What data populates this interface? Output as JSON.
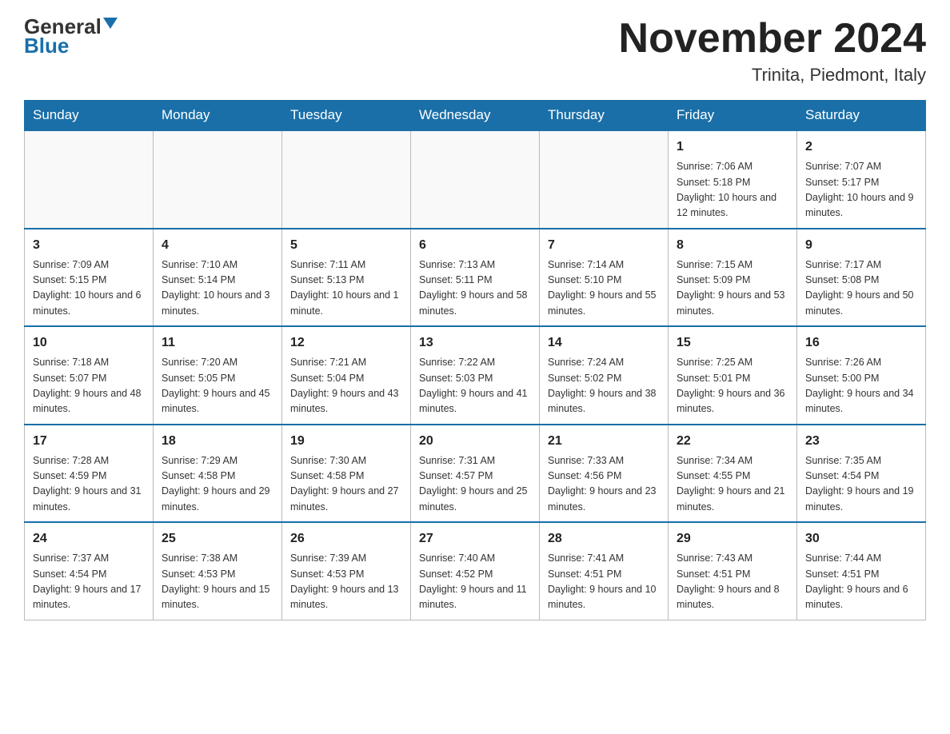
{
  "logo": {
    "general": "General",
    "blue": "Blue",
    "tagline": "GeneralBlue"
  },
  "title": "November 2024",
  "subtitle": "Trinita, Piedmont, Italy",
  "days_of_week": [
    "Sunday",
    "Monday",
    "Tuesday",
    "Wednesday",
    "Thursday",
    "Friday",
    "Saturday"
  ],
  "weeks": [
    [
      {
        "day": "",
        "info": ""
      },
      {
        "day": "",
        "info": ""
      },
      {
        "day": "",
        "info": ""
      },
      {
        "day": "",
        "info": ""
      },
      {
        "day": "",
        "info": ""
      },
      {
        "day": "1",
        "info": "Sunrise: 7:06 AM\nSunset: 5:18 PM\nDaylight: 10 hours\nand 12 minutes."
      },
      {
        "day": "2",
        "info": "Sunrise: 7:07 AM\nSunset: 5:17 PM\nDaylight: 10 hours\nand 9 minutes."
      }
    ],
    [
      {
        "day": "3",
        "info": "Sunrise: 7:09 AM\nSunset: 5:15 PM\nDaylight: 10 hours\nand 6 minutes."
      },
      {
        "day": "4",
        "info": "Sunrise: 7:10 AM\nSunset: 5:14 PM\nDaylight: 10 hours\nand 3 minutes."
      },
      {
        "day": "5",
        "info": "Sunrise: 7:11 AM\nSunset: 5:13 PM\nDaylight: 10 hours\nand 1 minute."
      },
      {
        "day": "6",
        "info": "Sunrise: 7:13 AM\nSunset: 5:11 PM\nDaylight: 9 hours\nand 58 minutes."
      },
      {
        "day": "7",
        "info": "Sunrise: 7:14 AM\nSunset: 5:10 PM\nDaylight: 9 hours\nand 55 minutes."
      },
      {
        "day": "8",
        "info": "Sunrise: 7:15 AM\nSunset: 5:09 PM\nDaylight: 9 hours\nand 53 minutes."
      },
      {
        "day": "9",
        "info": "Sunrise: 7:17 AM\nSunset: 5:08 PM\nDaylight: 9 hours\nand 50 minutes."
      }
    ],
    [
      {
        "day": "10",
        "info": "Sunrise: 7:18 AM\nSunset: 5:07 PM\nDaylight: 9 hours\nand 48 minutes."
      },
      {
        "day": "11",
        "info": "Sunrise: 7:20 AM\nSunset: 5:05 PM\nDaylight: 9 hours\nand 45 minutes."
      },
      {
        "day": "12",
        "info": "Sunrise: 7:21 AM\nSunset: 5:04 PM\nDaylight: 9 hours\nand 43 minutes."
      },
      {
        "day": "13",
        "info": "Sunrise: 7:22 AM\nSunset: 5:03 PM\nDaylight: 9 hours\nand 41 minutes."
      },
      {
        "day": "14",
        "info": "Sunrise: 7:24 AM\nSunset: 5:02 PM\nDaylight: 9 hours\nand 38 minutes."
      },
      {
        "day": "15",
        "info": "Sunrise: 7:25 AM\nSunset: 5:01 PM\nDaylight: 9 hours\nand 36 minutes."
      },
      {
        "day": "16",
        "info": "Sunrise: 7:26 AM\nSunset: 5:00 PM\nDaylight: 9 hours\nand 34 minutes."
      }
    ],
    [
      {
        "day": "17",
        "info": "Sunrise: 7:28 AM\nSunset: 4:59 PM\nDaylight: 9 hours\nand 31 minutes."
      },
      {
        "day": "18",
        "info": "Sunrise: 7:29 AM\nSunset: 4:58 PM\nDaylight: 9 hours\nand 29 minutes."
      },
      {
        "day": "19",
        "info": "Sunrise: 7:30 AM\nSunset: 4:58 PM\nDaylight: 9 hours\nand 27 minutes."
      },
      {
        "day": "20",
        "info": "Sunrise: 7:31 AM\nSunset: 4:57 PM\nDaylight: 9 hours\nand 25 minutes."
      },
      {
        "day": "21",
        "info": "Sunrise: 7:33 AM\nSunset: 4:56 PM\nDaylight: 9 hours\nand 23 minutes."
      },
      {
        "day": "22",
        "info": "Sunrise: 7:34 AM\nSunset: 4:55 PM\nDaylight: 9 hours\nand 21 minutes."
      },
      {
        "day": "23",
        "info": "Sunrise: 7:35 AM\nSunset: 4:54 PM\nDaylight: 9 hours\nand 19 minutes."
      }
    ],
    [
      {
        "day": "24",
        "info": "Sunrise: 7:37 AM\nSunset: 4:54 PM\nDaylight: 9 hours\nand 17 minutes."
      },
      {
        "day": "25",
        "info": "Sunrise: 7:38 AM\nSunset: 4:53 PM\nDaylight: 9 hours\nand 15 minutes."
      },
      {
        "day": "26",
        "info": "Sunrise: 7:39 AM\nSunset: 4:53 PM\nDaylight: 9 hours\nand 13 minutes."
      },
      {
        "day": "27",
        "info": "Sunrise: 7:40 AM\nSunset: 4:52 PM\nDaylight: 9 hours\nand 11 minutes."
      },
      {
        "day": "28",
        "info": "Sunrise: 7:41 AM\nSunset: 4:51 PM\nDaylight: 9 hours\nand 10 minutes."
      },
      {
        "day": "29",
        "info": "Sunrise: 7:43 AM\nSunset: 4:51 PM\nDaylight: 9 hours\nand 8 minutes."
      },
      {
        "day": "30",
        "info": "Sunrise: 7:44 AM\nSunset: 4:51 PM\nDaylight: 9 hours\nand 6 minutes."
      }
    ]
  ]
}
